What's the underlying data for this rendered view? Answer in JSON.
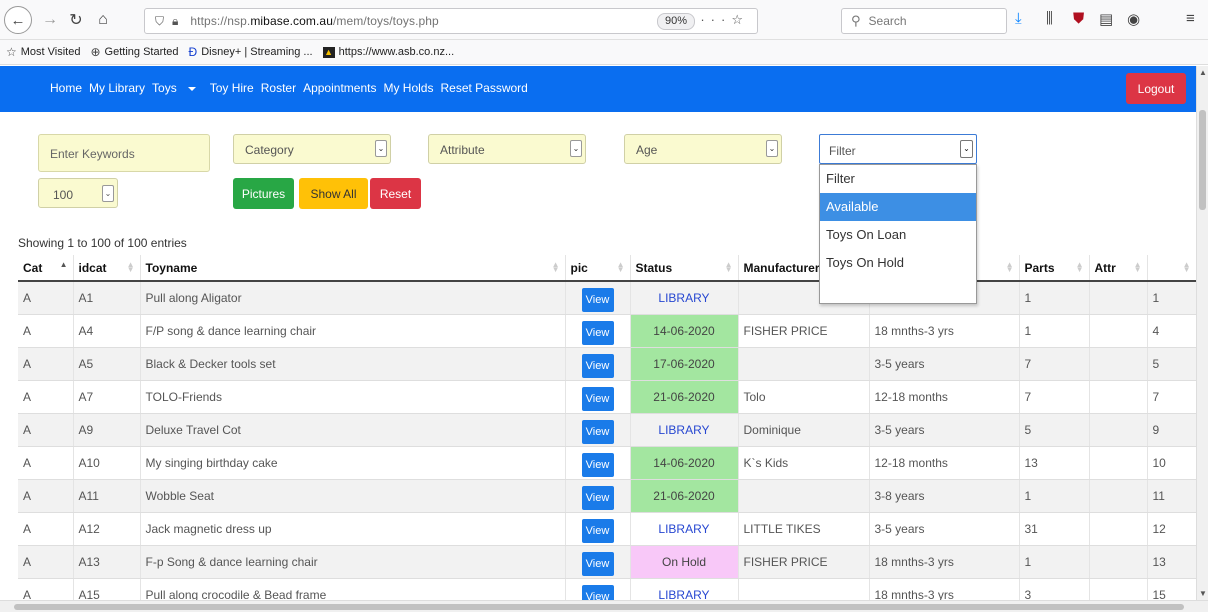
{
  "browser": {
    "url_prefix": "https://nsp.",
    "url_domain": "mibase.com.au",
    "url_path": "/mem/toys/toys.php",
    "zoom": "90%",
    "search_placeholder": "Search",
    "bookmarks": [
      "Most Visited",
      "Getting Started",
      "Disney+ | Streaming ...",
      "https://www.asb.co.nz..."
    ]
  },
  "nav": {
    "items": [
      "Home",
      "My Library",
      "Toys",
      "Toy Hire",
      "Roster",
      "Appointments",
      "My Holds",
      "Reset Password"
    ],
    "logout": "Logout"
  },
  "filters": {
    "keywords_placeholder": "Enter Keywords",
    "category": "Category",
    "attribute": "Attribute",
    "age": "Age",
    "filter": "Filter",
    "per_page": "100",
    "pictures": "Pictures",
    "show_all": "Show All",
    "reset": "Reset"
  },
  "filter_dropdown": {
    "options": [
      "Filter",
      "Available",
      "Toys On Loan",
      "Toys On Hold"
    ],
    "highlighted": "Available"
  },
  "table": {
    "showing": "Showing 1 to 100 of 100 entries",
    "headers": [
      "Cat",
      "idcat",
      "Toyname",
      "pic",
      "Status",
      "Manufacturer",
      "",
      "Parts",
      "Attr",
      ""
    ],
    "view_label": "View",
    "rows": [
      {
        "cat": "A",
        "idcat": "A1",
        "name": "Pull along Aligator",
        "status": "LIBRARY",
        "status_type": "lib",
        "manufacturer": "",
        "age": "",
        "parts": "1",
        "attr": "",
        "no": "1"
      },
      {
        "cat": "A",
        "idcat": "A4",
        "name": "F/P song & dance learning chair",
        "status": "14-06-2020",
        "status_type": "date",
        "manufacturer": "FISHER PRICE",
        "age": "18 mnths-3 yrs",
        "parts": "1",
        "attr": "",
        "no": "4"
      },
      {
        "cat": "A",
        "idcat": "A5",
        "name": "Black & Decker tools set",
        "status": "17-06-2020",
        "status_type": "date",
        "manufacturer": "",
        "age": "3-5 years",
        "parts": "7",
        "attr": "",
        "no": "5"
      },
      {
        "cat": "A",
        "idcat": "A7",
        "name": "TOLO-Friends",
        "status": "21-06-2020",
        "status_type": "date",
        "manufacturer": "Tolo",
        "age": "12-18 months",
        "parts": "7",
        "attr": "",
        "no": "7"
      },
      {
        "cat": "A",
        "idcat": "A9",
        "name": "Deluxe Travel Cot",
        "status": "LIBRARY",
        "status_type": "lib",
        "manufacturer": "Dominique",
        "age": "3-5 years",
        "parts": "5",
        "attr": "",
        "no": "9"
      },
      {
        "cat": "A",
        "idcat": "A10",
        "name": "My singing birthday cake",
        "status": "14-06-2020",
        "status_type": "date",
        "manufacturer": "K`s Kids",
        "age": "12-18 months",
        "parts": "13",
        "attr": "",
        "no": "10"
      },
      {
        "cat": "A",
        "idcat": "A11",
        "name": "Wobble Seat",
        "status": "21-06-2020",
        "status_type": "date",
        "manufacturer": "",
        "age": "3-8 years",
        "parts": "1",
        "attr": "",
        "no": "11"
      },
      {
        "cat": "A",
        "idcat": "A12",
        "name": "Jack magnetic dress up",
        "status": "LIBRARY",
        "status_type": "lib",
        "manufacturer": "LITTLE TIKES",
        "age": "3-5 years",
        "parts": "31",
        "attr": "",
        "no": "12"
      },
      {
        "cat": "A",
        "idcat": "A13",
        "name": "F-p Song & dance learning chair",
        "status": "On Hold",
        "status_type": "hold",
        "manufacturer": "FISHER PRICE",
        "age": "18 mnths-3 yrs",
        "parts": "1",
        "attr": "",
        "no": "13"
      },
      {
        "cat": "A",
        "idcat": "A15",
        "name": "Pull along crocodile & Bead frame",
        "status": "LIBRARY",
        "status_type": "lib",
        "manufacturer": "",
        "age": "18 mnths-3 yrs",
        "parts": "3",
        "attr": "",
        "no": "15"
      }
    ]
  },
  "colors": {
    "navbar": "#0a6ef0",
    "logout": "#dc3545",
    "pictures": "#28a745",
    "show_all": "#ffc107",
    "reset": "#dc3545",
    "date_status": "#a3e6a0",
    "hold_status": "#f8c8f8",
    "library_text": "#2747d1",
    "view_button": "#1a7be9"
  }
}
